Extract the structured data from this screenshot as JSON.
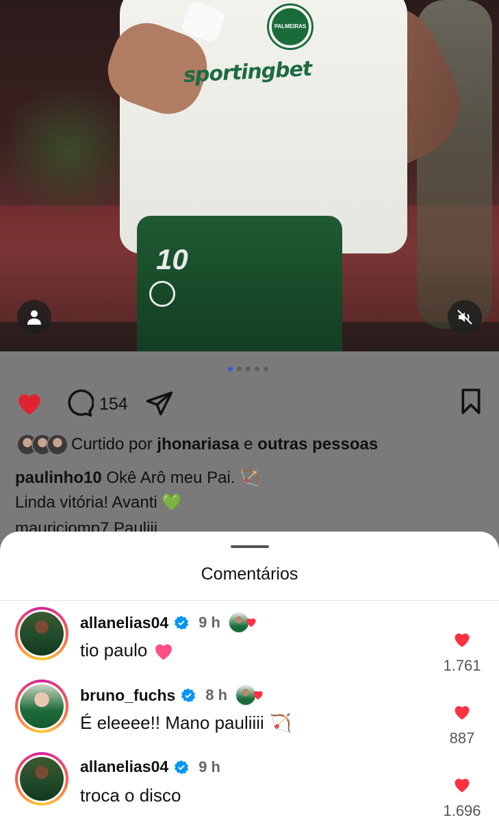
{
  "post": {
    "comment_count": "154",
    "liked_by_prefix": "Curtido por",
    "liked_by_user": "jhonariasa",
    "liked_by_joiner": "e",
    "liked_by_others": "outras pessoas",
    "caption_user": "paulinho10",
    "caption_line1": "Okê Arô meu Pai.",
    "caption_line2": "Linda vitória! Avanti",
    "peek_comment": "mauriciomp7 Pauliii",
    "carousel_total": 5,
    "carousel_active": 1,
    "jersey_sponsor": "sportingbet",
    "jersey_crest": "PALMEIRAS",
    "shorts_number": "10"
  },
  "sheet": {
    "title": "Comentários"
  },
  "comments": [
    {
      "user": "allanelias04",
      "time": "9 h",
      "text": "tio paulo",
      "likes": "1.761",
      "emoji": "pink-heart"
    },
    {
      "user": "bruno_fuchs",
      "time": "8 h",
      "text": "É eleeee!! Mano pauliiii",
      "likes": "887",
      "emoji": "bow-and-arrow"
    },
    {
      "user": "allanelias04",
      "time": "9 h",
      "text": "troca o disco",
      "likes": "1.696",
      "emoji": ""
    }
  ],
  "icons": {
    "like": "heart-icon",
    "comment": "comment-bubble-icon",
    "share": "paper-plane-icon",
    "save": "bookmark-icon",
    "user": "user-tag-icon",
    "mute": "speaker-muted-icon",
    "verified": "verified-badge-icon"
  },
  "colors": {
    "like_red": "#ff3040",
    "verified_blue": "#0095f6",
    "active_dot": "#3b5bdb"
  }
}
